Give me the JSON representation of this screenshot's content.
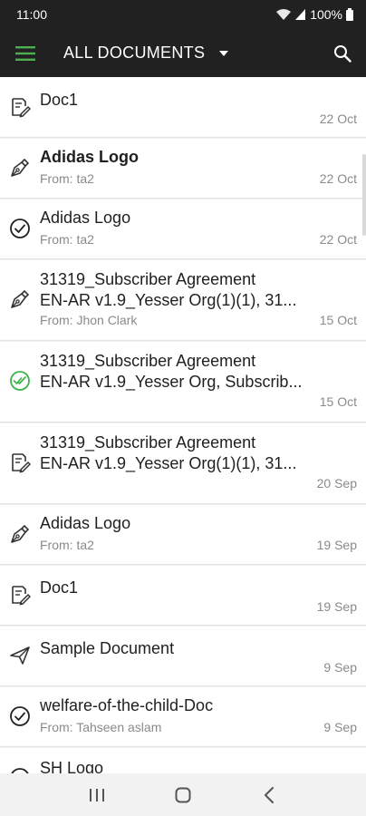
{
  "status_bar": {
    "time": "11:00",
    "battery": "100%"
  },
  "app_bar": {
    "title": "ALL DOCUMENTS",
    "menu_icon": "hamburger-menu-icon",
    "dropdown_icon": "caret-down-icon",
    "search_icon": "search-icon",
    "accent_color": "#4caf50"
  },
  "documents": [
    {
      "icon": "edit-document-icon",
      "title": "Doc1",
      "title2": "",
      "from": "",
      "date": "22 Oct",
      "bold": false
    },
    {
      "icon": "pen-nib-icon",
      "title": "Adidas Logo",
      "title2": "",
      "from": "From: ta2",
      "date": "22 Oct",
      "bold": true
    },
    {
      "icon": "check-circle-icon",
      "title": "Adidas Logo",
      "title2": "",
      "from": "From: ta2",
      "date": "22 Oct",
      "bold": false
    },
    {
      "icon": "pen-nib-icon",
      "title": "31319_Subscriber Agreement",
      "title2": "EN-AR v1.9_Yesser Org(1)(1), 31...",
      "from": "From: Jhon Clark",
      "date": "15 Oct",
      "bold": false
    },
    {
      "icon": "double-check-circle-icon",
      "title": "31319_Subscriber Agreement",
      "title2": "EN-AR v1.9_Yesser Org, Subscrib...",
      "from": "",
      "date": "15 Oct",
      "bold": false
    },
    {
      "icon": "edit-document-icon",
      "title": "31319_Subscriber Agreement",
      "title2": "EN-AR v1.9_Yesser Org(1)(1), 31...",
      "from": "",
      "date": "20 Sep",
      "bold": false
    },
    {
      "icon": "pen-nib-icon",
      "title": "Adidas Logo",
      "title2": "",
      "from": "From: ta2",
      "date": "19 Sep",
      "bold": false
    },
    {
      "icon": "edit-document-icon",
      "title": "Doc1",
      "title2": "",
      "from": "",
      "date": "19 Sep",
      "bold": false
    },
    {
      "icon": "paper-plane-icon",
      "title": "Sample Document",
      "title2": "",
      "from": "",
      "date": "9 Sep",
      "bold": false
    },
    {
      "icon": "check-circle-icon",
      "title": "welfare-of-the-child-Doc",
      "title2": "",
      "from": "From: Tahseen aslam",
      "date": "9 Sep",
      "bold": false
    },
    {
      "icon": "check-circle-icon",
      "title": "SH Logo",
      "title2": "",
      "from": "",
      "date": "",
      "bold": false
    }
  ],
  "nav_bar": {
    "recents_icon": "recent-apps-icon",
    "home_icon": "home-icon",
    "back_icon": "back-icon"
  }
}
